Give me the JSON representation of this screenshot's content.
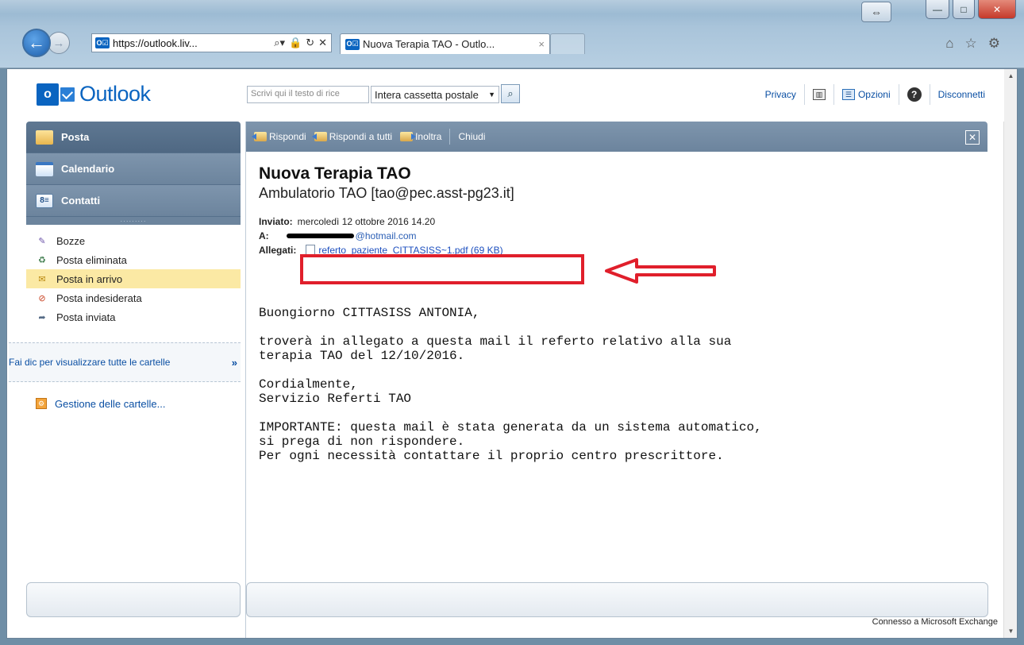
{
  "browser": {
    "address_url": "https://outlook.liv...",
    "tab_title": "Nuova Terapia TAO - Outlo...",
    "tab_close": "×",
    "window_controls": {
      "resize": "⇔",
      "minimize": "—",
      "maximize": "□",
      "close": "✕"
    }
  },
  "header": {
    "logo_text": "Outlook",
    "logo_letter": "o",
    "search_placeholder": "Scrivi qui il testo di rice",
    "search_scope": "Intera cassetta postale",
    "links": {
      "privacy": "Privacy",
      "options": "Opzioni",
      "help": "?",
      "signout": "Disconnetti"
    }
  },
  "nav": {
    "modules": [
      {
        "label": "Posta",
        "icon": "mail-icon"
      },
      {
        "label": "Calendario",
        "icon": "calendar-icon"
      },
      {
        "label": "Contatti",
        "icon": "contacts-icon"
      }
    ],
    "folders": [
      {
        "label": "Bozze",
        "icon": "drafts-icon"
      },
      {
        "label": "Posta eliminata",
        "icon": "trash-icon"
      },
      {
        "label": "Posta in arrivo",
        "icon": "inbox-icon",
        "selected": true
      },
      {
        "label": "Posta indesiderata",
        "icon": "junk-icon"
      },
      {
        "label": "Posta inviata",
        "icon": "sent-icon"
      }
    ],
    "all_folders_link": "Fai dic per visualizzare tutte le cartelle",
    "manage_folders": "Gestione delle cartelle..."
  },
  "toolbar": {
    "reply": "Rispondi",
    "reply_all": "Rispondi a tutti",
    "forward": "Inoltra",
    "close": "Chiudi"
  },
  "message": {
    "subject": "Nuova Terapia TAO",
    "from": "Ambulatorio TAO [tao@pec.asst-pg23.it]",
    "sent_label": "Inviato:",
    "sent_value": "mercoledì 12 ottobre 2016 14.20",
    "to_label": "A:",
    "to_value_visible": "@hotmail.com",
    "attachments_label": "Allegati:",
    "attachment": "referto_paziente_CITTASISS~1.pdf (69 KB)",
    "body": [
      "Buongiorno CITTASISS ANTONIA,",
      "troverà in allegato a questa mail il referto relativo alla sua\nterapia TAO del 12/10/2016.",
      "Cordialmente,\nServizio Referti TAO",
      "IMPORTANTE: questa mail è stata generata da un sistema automatico,\nsi prega di non rispondere.\nPer ogni necessità contattare il proprio centro prescrittore."
    ]
  },
  "status_text": "Connesso a Microsoft Exchange",
  "colors": {
    "annotation_red": "#e01f2b",
    "outlook_blue": "#0a64c0",
    "nav_gray": "#6c849d",
    "selected_folder": "#fbe9a4"
  }
}
